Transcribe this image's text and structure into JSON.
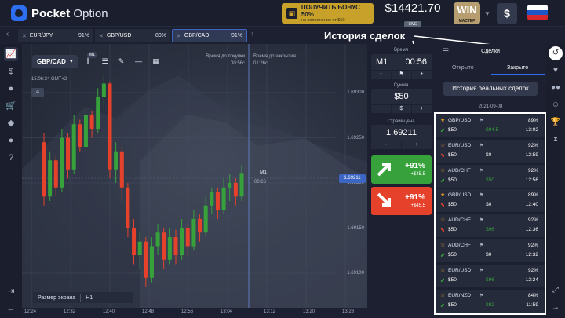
{
  "header": {
    "logo_bold": "Pocket",
    "logo_rest": " Option",
    "bonus_title": "ПОЛУЧИТЬ БОНУС 50%",
    "bonus_sub": "на пополнение от $50",
    "balance": "$14421.70",
    "balance_badge": "LIVE",
    "status_word": "WIN",
    "status_level": "МАСТЕР",
    "currency_symbol": "$"
  },
  "asset_tabs": [
    {
      "label": "EUR/JPY",
      "payout": "91%"
    },
    {
      "label": "GBP/USD",
      "payout": "80%"
    },
    {
      "label": "GBP/CAD",
      "payout": "91%"
    }
  ],
  "annotation": "История сделок",
  "chart": {
    "pair": "GBP/CAD",
    "timeframe_badge": "M1",
    "clock": "15:06:34 GMT+2",
    "a_badge": "A",
    "buy_time_label": "Время до покупки",
    "buy_time_value": "00:56с",
    "close_time_label": "Время до закрытия",
    "close_time_value": "01:26с",
    "price_ticks": [
      "1.69300",
      "1.69250",
      "1.69200",
      "1.69150",
      "1.69100"
    ],
    "current_price": "1.69211",
    "marker_tf": "M1",
    "marker_timer": "00:26",
    "screen_size_label": "Размер экрана",
    "screen_size_value": "H1",
    "time_ticks": [
      "12:24",
      "12:32",
      "12:40",
      "12:48",
      "12:56",
      "13:04",
      "13:12",
      "13:20",
      "13:28"
    ]
  },
  "trade_panel": {
    "time_label": "Время",
    "time_value": "M1",
    "time_value2": "00:56",
    "minus": "-",
    "plus": "+",
    "sum_label": "Сумма",
    "sum_value": "$50",
    "sum_currency": "$",
    "strike_label": "Страйк-цена",
    "strike_value": "1.69211",
    "buy_pct": "+91%",
    "buy_amt": "+$45.5",
    "sell_pct": "+91%",
    "sell_amt": "+$45.5"
  },
  "trades": {
    "title": "Сделки",
    "tab_open": "Открыто",
    "tab_closed": "Закрыто",
    "real_button": "История реальных сделок",
    "date": "2021-09-08",
    "items": [
      {
        "pair": "GBP/USD",
        "pct": "89%",
        "dir": "up",
        "amount": "$50",
        "payout": "$94.5",
        "time": "13:02",
        "win": true
      },
      {
        "pair": "EUR/USD",
        "pct": "92%",
        "dir": "down",
        "amount": "$50",
        "payout": "$0",
        "time": "12:59",
        "win": false
      },
      {
        "pair": "AUD/CHF",
        "pct": "92%",
        "dir": "up",
        "amount": "$50",
        "payout": "$50",
        "time": "12:56",
        "win": true
      },
      {
        "pair": "GBP/USD",
        "pct": "89%",
        "dir": "down",
        "amount": "$50",
        "payout": "$0",
        "time": "12:40",
        "win": false
      },
      {
        "pair": "AUD/CHF",
        "pct": "92%",
        "dir": "down",
        "amount": "$50",
        "payout": "$96",
        "time": "12:36",
        "win": true
      },
      {
        "pair": "AUD/CHF",
        "pct": "92%",
        "dir": "up",
        "amount": "$50",
        "payout": "$0",
        "time": "12:32",
        "win": false
      },
      {
        "pair": "EUR/USD",
        "pct": "92%",
        "dir": "up",
        "amount": "$50",
        "payout": "$96",
        "time": "12:24",
        "win": true
      },
      {
        "pair": "EUR/NZD",
        "pct": "84%",
        "dir": "up",
        "amount": "$50",
        "payout": "$92",
        "time": "11:59",
        "win": true
      }
    ]
  },
  "colors": {
    "accent": "#2e6ff2",
    "up": "#37a23c",
    "down": "#e6412b",
    "bonus": "#c8a12b",
    "flag_white": "#ffffff",
    "flag_blue": "#1c56c9",
    "flag_red": "#d7282f"
  },
  "candles": [
    {
      "o": 1.69245,
      "c": 1.69185,
      "h": 1.69255,
      "l": 1.69175
    },
    {
      "o": 1.69185,
      "c": 1.69225,
      "h": 1.69235,
      "l": 1.6918
    },
    {
      "o": 1.69225,
      "c": 1.69195,
      "h": 1.6923,
      "l": 1.69185
    },
    {
      "o": 1.69195,
      "c": 1.6925,
      "h": 1.6926,
      "l": 1.6919
    },
    {
      "o": 1.6925,
      "c": 1.69215,
      "h": 1.69255,
      "l": 1.69205
    },
    {
      "o": 1.69215,
      "c": 1.69265,
      "h": 1.69275,
      "l": 1.6921
    },
    {
      "o": 1.69265,
      "c": 1.6924,
      "h": 1.6927,
      "l": 1.69235
    },
    {
      "o": 1.6924,
      "c": 1.69275,
      "h": 1.69285,
      "l": 1.69235
    },
    {
      "o": 1.69275,
      "c": 1.6926,
      "h": 1.6928,
      "l": 1.6925
    },
    {
      "o": 1.6926,
      "c": 1.69295,
      "h": 1.69305,
      "l": 1.69255
    },
    {
      "o": 1.69295,
      "c": 1.6931,
      "h": 1.6932,
      "l": 1.69285
    },
    {
      "o": 1.6931,
      "c": 1.69215,
      "h": 1.69312,
      "l": 1.69205
    },
    {
      "o": 1.69215,
      "c": 1.69235,
      "h": 1.69245,
      "l": 1.692
    },
    {
      "o": 1.69235,
      "c": 1.69195,
      "h": 1.6924,
      "l": 1.6918
    },
    {
      "o": 1.69195,
      "c": 1.6915,
      "h": 1.692,
      "l": 1.6914
    },
    {
      "o": 1.6915,
      "c": 1.6912,
      "h": 1.6916,
      "l": 1.6911
    },
    {
      "o": 1.6912,
      "c": 1.69135,
      "h": 1.69145,
      "l": 1.69105
    },
    {
      "o": 1.69135,
      "c": 1.69095,
      "h": 1.6914,
      "l": 1.69085
    },
    {
      "o": 1.69095,
      "c": 1.6913,
      "h": 1.6914,
      "l": 1.6909
    },
    {
      "o": 1.6913,
      "c": 1.69145,
      "h": 1.69155,
      "l": 1.6912
    },
    {
      "o": 1.69145,
      "c": 1.69115,
      "h": 1.6915,
      "l": 1.69105
    },
    {
      "o": 1.69115,
      "c": 1.6914,
      "h": 1.6915,
      "l": 1.6911
    },
    {
      "o": 1.6914,
      "c": 1.6912,
      "h": 1.69148,
      "l": 1.6911
    },
    {
      "o": 1.6912,
      "c": 1.6915,
      "h": 1.6916,
      "l": 1.69115
    },
    {
      "o": 1.6915,
      "c": 1.6913,
      "h": 1.69155,
      "l": 1.6912
    },
    {
      "o": 1.6913,
      "c": 1.6916,
      "h": 1.6917,
      "l": 1.69125
    },
    {
      "o": 1.6916,
      "c": 1.69145,
      "h": 1.69165,
      "l": 1.69135
    },
    {
      "o": 1.69145,
      "c": 1.69175,
      "h": 1.69185,
      "l": 1.6914
    },
    {
      "o": 1.69175,
      "c": 1.6919,
      "h": 1.69195,
      "l": 1.69165
    },
    {
      "o": 1.6919,
      "c": 1.6917,
      "h": 1.69195,
      "l": 1.6916
    },
    {
      "o": 1.6917,
      "c": 1.69195,
      "h": 1.69205,
      "l": 1.69165
    },
    {
      "o": 1.69195,
      "c": 1.692,
      "h": 1.6921,
      "l": 1.6918
    },
    {
      "o": 1.692,
      "c": 1.69185,
      "h": 1.69205,
      "l": 1.69175
    },
    {
      "o": 1.69185,
      "c": 1.69211,
      "h": 1.6922,
      "l": 1.6918
    }
  ]
}
